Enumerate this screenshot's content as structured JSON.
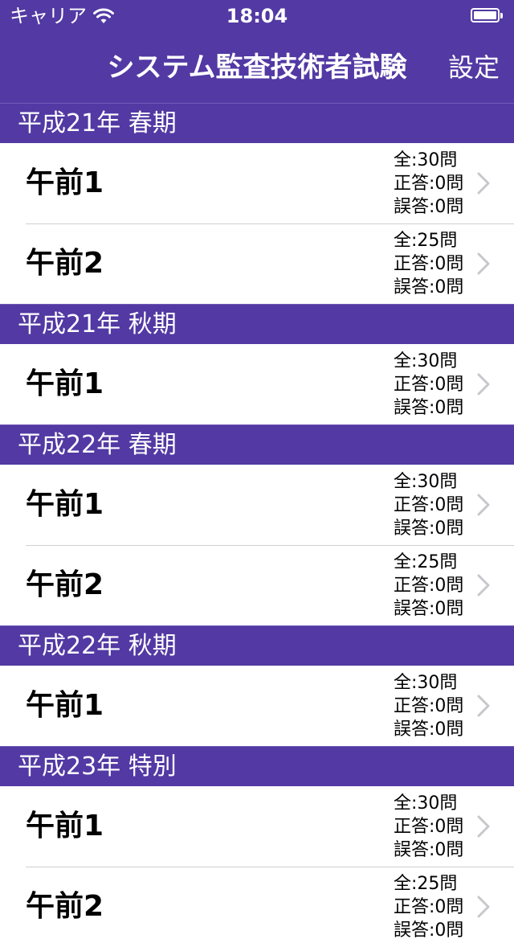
{
  "status_bar": {
    "carrier": "キャリア",
    "time": "18:04"
  },
  "nav": {
    "title": "システム監査技術者試験",
    "settings_label": "設定"
  },
  "colors": {
    "accent": "#5239a3",
    "chevron": "#c7c7cc"
  },
  "sections": [
    {
      "title": "平成21年 春期",
      "rows": [
        {
          "title": "午前1",
          "total": "全:30問",
          "correct": "正答:0問",
          "wrong": "誤答:0問"
        },
        {
          "title": "午前2",
          "total": "全:25問",
          "correct": "正答:0問",
          "wrong": "誤答:0問"
        }
      ]
    },
    {
      "title": "平成21年 秋期",
      "rows": [
        {
          "title": "午前1",
          "total": "全:30問",
          "correct": "正答:0問",
          "wrong": "誤答:0問"
        }
      ]
    },
    {
      "title": "平成22年 春期",
      "rows": [
        {
          "title": "午前1",
          "total": "全:30問",
          "correct": "正答:0問",
          "wrong": "誤答:0問"
        },
        {
          "title": "午前2",
          "total": "全:25問",
          "correct": "正答:0問",
          "wrong": "誤答:0問"
        }
      ]
    },
    {
      "title": "平成22年 秋期",
      "rows": [
        {
          "title": "午前1",
          "total": "全:30問",
          "correct": "正答:0問",
          "wrong": "誤答:0問"
        }
      ]
    },
    {
      "title": "平成23年 特別",
      "rows": [
        {
          "title": "午前1",
          "total": "全:30問",
          "correct": "正答:0問",
          "wrong": "誤答:0問"
        },
        {
          "title": "午前2",
          "total": "全:25問",
          "correct": "正答:0問",
          "wrong": "誤答:0問"
        }
      ]
    }
  ]
}
